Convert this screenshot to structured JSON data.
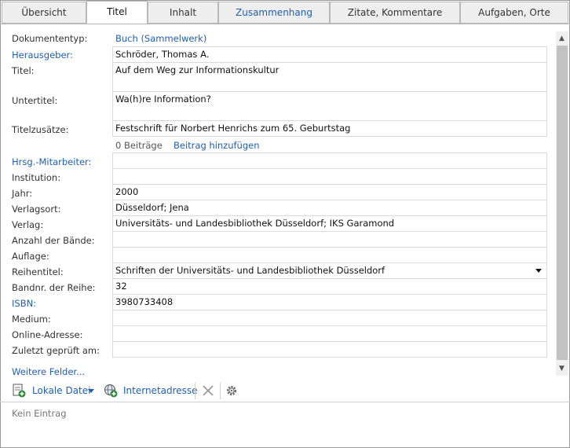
{
  "tabs": [
    {
      "label": "Übersicht"
    },
    {
      "label": "Titel"
    },
    {
      "label": "Inhalt"
    },
    {
      "label": "Zusammenhang"
    },
    {
      "label": "Zitate, Kommentare"
    },
    {
      "label": "Aufgaben, Orte"
    }
  ],
  "active_tab": "Titel",
  "form": {
    "doctype_label": "Dokumententyp:",
    "doctype_value": "Buch (Sammelwerk)",
    "editor_label": "Herausgeber:",
    "editor_value": "Schröder, Thomas A.",
    "title_label": "Titel:",
    "title_value": "Auf dem Weg zur Informationskultur",
    "subtitle_label": "Untertitel:",
    "subtitle_value": "Wa(h)re Information?",
    "title_add_label": "Titelzusätze:",
    "title_add_value": "Festschrift für Norbert Henrichs zum 65. Geburtstag",
    "contributions_count": "0 Beiträge",
    "add_contribution": "Beitrag hinzufügen",
    "coeditors_label": "Hrsg.-Mitarbeiter:",
    "coeditors_value": "",
    "institution_label": "Institution:",
    "institution_value": "",
    "year_label": "Jahr:",
    "year_value": "2000",
    "place_label": "Verlagsort:",
    "place_value": "Düsseldorf; Jena",
    "publisher_label": "Verlag:",
    "publisher_value": "Universitäts- und Landesbibliothek Düsseldorf; IKS Garamond",
    "volumes_label": "Anzahl der Bände:",
    "volumes_value": "",
    "edition_label": "Auflage:",
    "edition_value": "",
    "series_label": "Reihentitel:",
    "series_value": "Schriften der Universitäts- und Landesbibliothek Düsseldorf",
    "series_no_label": "Bandnr. der Reihe:",
    "series_no_value": "32",
    "isbn_label": "ISBN:",
    "isbn_value": "3980733408",
    "medium_label": "Medium:",
    "medium_value": "",
    "online_label": "Online-Adresse:",
    "online_value": "",
    "checked_label": "Zuletzt geprüft am:",
    "checked_value": "",
    "more_fields": "Weitere Felder..."
  },
  "toolbar": {
    "local_file": "Lokale Datei",
    "web_address": "Internetadresse"
  },
  "attachments_empty": "Kein Eintrag",
  "colors": {
    "link": "#1f5fb4",
    "accent_icon": "#2e8b3a"
  },
  "icons": [
    "local-file-icon",
    "web-address-icon",
    "delete-icon",
    "settings-icon",
    "dropdown-arrow-icon"
  ]
}
